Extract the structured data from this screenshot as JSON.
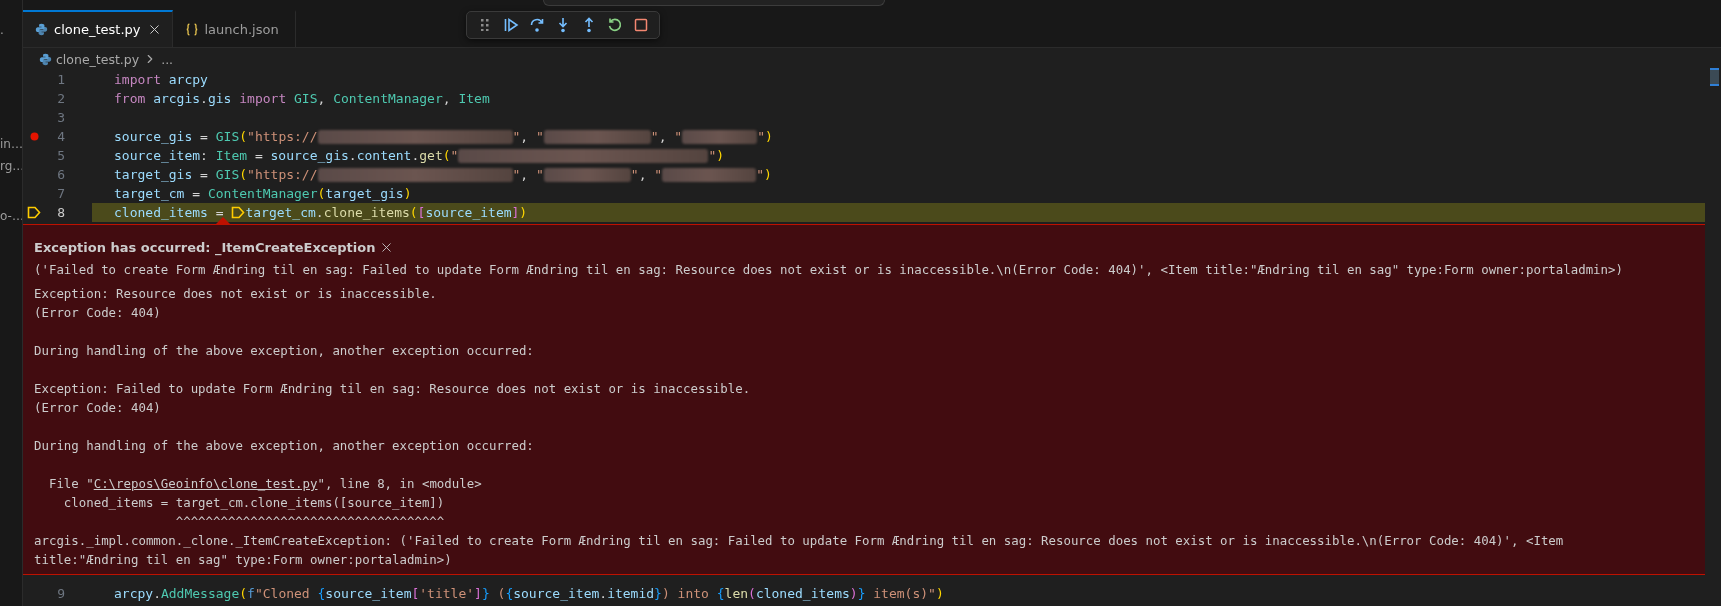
{
  "sidebar_fragments": [
    "·",
    "in…",
    "rg…",
    "o-…"
  ],
  "tabs": [
    {
      "label": "clone_test.py",
      "kind": "python",
      "selected": true
    },
    {
      "label": "launch.json",
      "kind": "json",
      "selected": false
    }
  ],
  "debug_toolbar": [
    {
      "kind": "drag"
    },
    {
      "kind": "continue"
    },
    {
      "kind": "step_over"
    },
    {
      "kind": "step_into"
    },
    {
      "kind": "step_out"
    },
    {
      "kind": "restart"
    },
    {
      "kind": "stop"
    }
  ],
  "breadcrumb": {
    "file": "clone_test.py",
    "more": "..."
  },
  "code_lines": [
    {
      "number": "1",
      "breakpoint": false,
      "stack_frame": false,
      "current": false,
      "parts": [
        "import arcpy"
      ]
    },
    {
      "number": "2",
      "breakpoint": false,
      "stack_frame": false,
      "current": false,
      "parts": [
        "from arcgis.gis import GIS, ContentManager, Item"
      ]
    },
    {
      "number": "3",
      "breakpoint": false,
      "stack_frame": false,
      "current": false
    },
    {
      "number": "4",
      "kind": "redacted",
      "breakpoint": true,
      "stack_frame": false,
      "current": false,
      "parts": [
        "source_gis = GIS(\"https://",
        "\", \"",
        "\", \"",
        "\")"
      ]
    },
    {
      "number": "5",
      "kind": "redacted",
      "breakpoint": false,
      "stack_frame": false,
      "current": false,
      "parts": [
        "source_item: Item = source_gis.content.get(\"",
        "\")"
      ]
    },
    {
      "number": "6",
      "kind": "redacted",
      "breakpoint": false,
      "stack_frame": false,
      "current": false,
      "parts": [
        "target_gis = GIS(\"https://",
        "\", \"",
        "\", \"",
        "\")"
      ]
    },
    {
      "number": "7",
      "breakpoint": false,
      "stack_frame": false,
      "current": false,
      "parts": [
        "target_cm = ContentManager(target_gis)"
      ]
    },
    {
      "number": "8",
      "kind": "frame",
      "breakpoint": false,
      "stack_frame": true,
      "current": true,
      "parts": [
        "cloned_items = ",
        "target_cm.clone_items([source_item])"
      ]
    }
  ],
  "exception": {
    "title": "Exception has occurred: _ItemCreateException",
    "message": "('Failed to create Form Ændring til en sag: Failed to update Form Ændring til en sag: Resource does not exist or is inaccessible.\\n(Error Code: 404)', <Item title:\"Ændring til en sag\" type:Form owner:portaladmin>)",
    "blocks": [
      [
        {
          "kind": "text",
          "text": "Exception: Resource does not exist or is inaccessible."
        },
        {
          "kind": "text",
          "text": "(Error Code: 404)"
        }
      ],
      [
        {
          "kind": "text",
          "text": "During handling of the above exception, another exception occurred:"
        }
      ],
      [
        {
          "kind": "text",
          "text": "Exception: Failed to update Form Ændring til en sag: Resource does not exist or is inaccessible."
        },
        {
          "kind": "text",
          "text": "(Error Code: 404)"
        }
      ],
      [
        {
          "kind": "text",
          "text": "During handling of the above exception, another exception occurred:"
        }
      ],
      [
        {
          "kind": "file",
          "prefix": "  File \"",
          "link": "C:\\repos\\Geoinfo\\clone_test.py",
          "suffix": "\", line 8, in <module>"
        },
        {
          "kind": "text",
          "text": "    cloned_items = target_cm.clone_items([source_item])"
        },
        {
          "kind": "text",
          "text": "                   ^^^^^^^^^^^^^^^^^^^^^^^^^^^^^^^^^^^^"
        },
        {
          "kind": "text",
          "text": "arcgis._impl.common._clone._ItemCreateException: ('Failed to create Form Ændring til en sag: Failed to update Form Ændring til en sag: Resource does not exist or is inaccessible.\\n(Error Code: 404)', <Item"
        },
        {
          "kind": "text",
          "text": "title:\"Ændring til en sag\" type:Form owner:portaladmin>)"
        }
      ]
    ]
  },
  "after_lines": [
    {
      "number": "9",
      "breakpoint": false,
      "stack_frame": false,
      "current": false,
      "parts": [
        "arcpy.AddMessage(f\"Cloned {source_item['title']} ({source_item.itemid}) into {len(cloned_items)} item(s)\")"
      ]
    }
  ]
}
